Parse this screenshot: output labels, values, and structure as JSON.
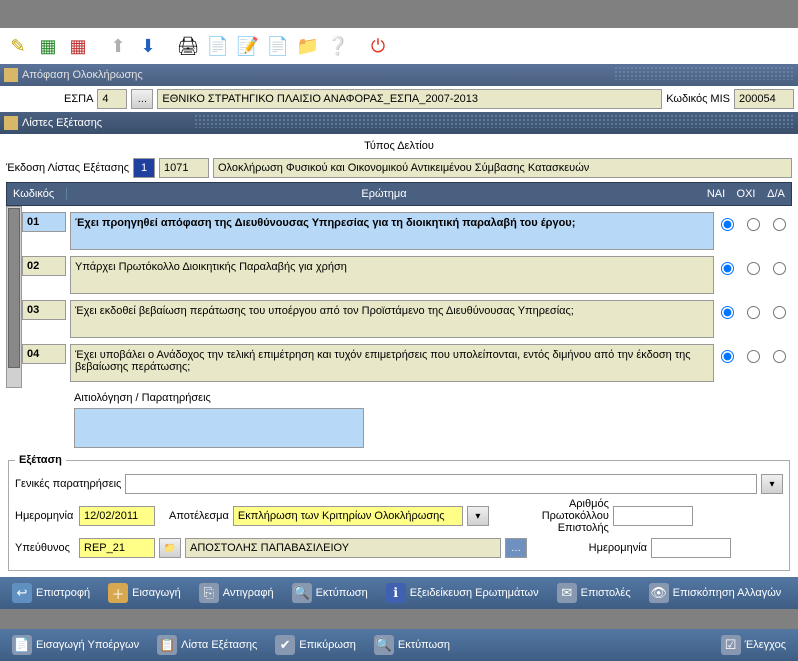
{
  "toolbar_icons": [
    "pencil",
    "grid-add",
    "grid-del",
    "arrow-up",
    "arrow-down",
    "printer",
    "doc-search",
    "doc-edit",
    "doc-new",
    "folder",
    "help",
    "power"
  ],
  "panel1_title": "Απόφαση Ολοκλήρωσης",
  "espa": {
    "label": "ΕΣΠΑ",
    "code": "4",
    "desc": "ΕΘΝΙΚΟ ΣΤΡΑΤΗΓΙΚΟ ΠΛΑΙΣΙΟ ΑΝΑΦΟΡΑΣ_ΕΣΠΑ_2007-2013",
    "mis_label": "Κωδικός MIS",
    "mis_value": "200054"
  },
  "panel2_title": "Λίστες Εξέτασης",
  "type_label": "Τύπος Δελτίου",
  "filter": {
    "label": "Έκδοση Λίστας Εξέτασης",
    "v1": "1",
    "v2": "1071",
    "desc": "Ολοκλήρωση Φυσικού και Οικονομικού Αντικειμένου Σύμβασης Κατασκευών"
  },
  "grid": {
    "headers": {
      "code": "Κωδικός",
      "question": "Ερώτημα",
      "yes": "ΝΑΙ",
      "no": "ΟΧΙ",
      "na": "Δ/Α"
    },
    "rows": [
      {
        "code": "01",
        "text": "Έχει προηγηθεί απόφαση της Διευθύνουσας Υπηρεσίας για τη διοικητική παραλαβή του έργου;",
        "selected": true,
        "answer": "yes"
      },
      {
        "code": "02",
        "text": "Υπάρχει Πρωτόκολλο Διοικητικής Παραλαβής για χρήση",
        "answer": "yes"
      },
      {
        "code": "03",
        "text": "Έχει εκδοθεί βεβαίωση περάτωσης του υποέργου από τον Προϊστάμενο της Διευθύνουσας Υπηρεσίας;",
        "answer": "yes"
      },
      {
        "code": "04",
        "text": "Έχει υποβάλει ο Ανάδοχος την τελική επιμέτρηση και τυχόν επιμετρήσεις που υπολείπονται, εντός διμήνου από την έκδοση της βεβαίωσης περάτωσης;",
        "answer": "yes"
      }
    ]
  },
  "comments_label": "Αιτιολόγηση / Παρατηρήσεις",
  "exam": {
    "legend": "Εξέταση",
    "gen_label": "Γενικές παρατηρήσεις",
    "date_label": "Ημερομηνία",
    "date_value": "12/02/2011",
    "result_label": "Αποτέλεσμα",
    "result_value": "Εκπλήρωση των Κριτηρίων Ολοκλήρωσης",
    "protnum_label": "Αριθμός Πρωτοκόλλου Επιστολής",
    "resp_label": "Υπεύθυνος",
    "resp_code": "REP_21",
    "resp_name": "ΑΠΟΣΤΟΛΗΣ ΠΑΠΑΒΑΣΙΛΕΙΟΥ",
    "date2_label": "Ημερομηνία"
  },
  "actions1": {
    "b1": "Επιστροφή",
    "b2": "Εισαγωγή",
    "b3": "Αντιγραφή",
    "b4": "Εκτύπωση",
    "b5": "Εξειδείκευση Ερωτημάτων",
    "b6": "Επιστολές",
    "b7": "Επισκόπηση Αλλαγών"
  },
  "actions2": {
    "b1": "Εισαγωγή Υποέργων",
    "b2": "Λίστα Εξέτασης",
    "b3": "Επικύρωση",
    "b4": "Εκτύπωση",
    "b5": "Έλεγχος"
  }
}
